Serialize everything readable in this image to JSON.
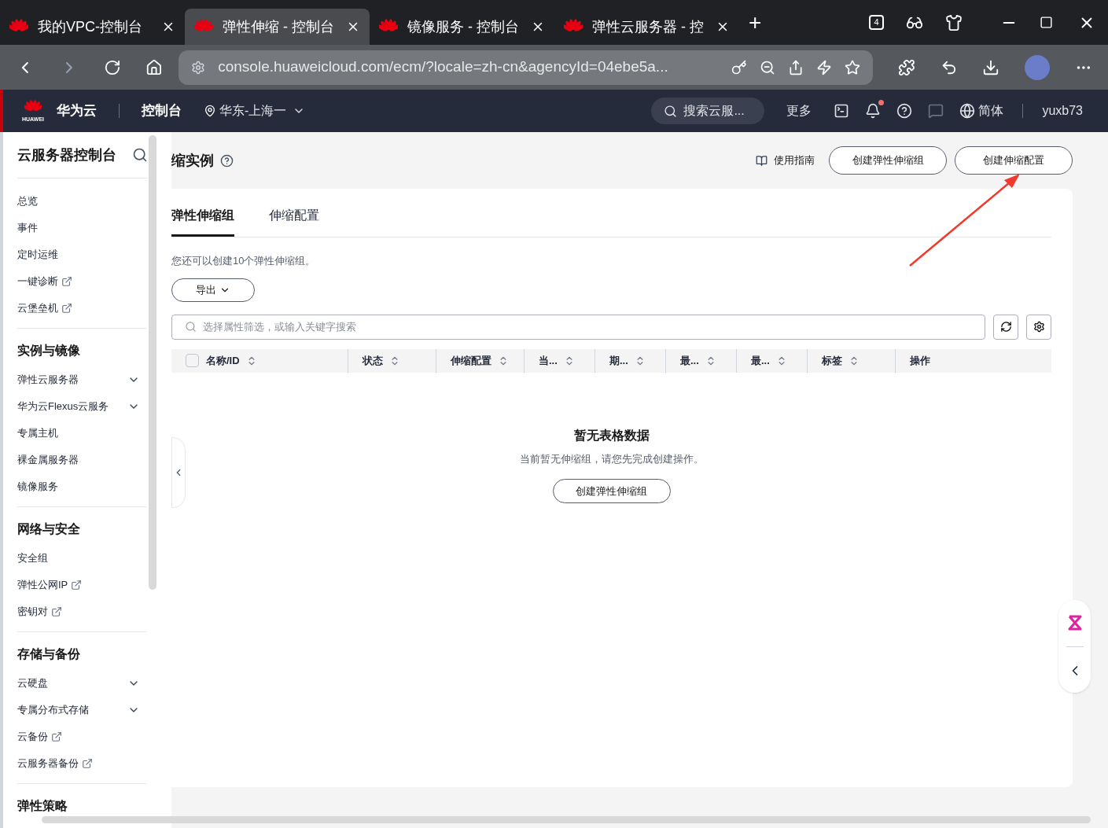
{
  "browser": {
    "tabs": [
      {
        "title": "我的VPC-控制台",
        "selected": false
      },
      {
        "title": "弹性伸缩 - 控制台",
        "selected": true
      },
      {
        "title": "镜像服务 - 控制台",
        "selected": false
      },
      {
        "title": "弹性云服务器 - 控",
        "selected": false
      }
    ],
    "new_tab": "+",
    "tab_count": "4",
    "url": "console.huaweicloud.com/ecm/?locale=zh-cn&agencyId=04ebe5a..."
  },
  "header": {
    "brand": "华为云",
    "logo_text": "HUAWEI",
    "console": "控制台",
    "region": "华东-上海一",
    "search_placeholder": "搜索云服...",
    "more": "更多",
    "language": "简体",
    "user": "yuxb73",
    "notification_dot": true
  },
  "sidebar": {
    "title": "云服务器控制台",
    "sections": [
      {
        "items": [
          {
            "label": "总览",
            "kind": "plain"
          },
          {
            "label": "事件",
            "kind": "plain"
          },
          {
            "label": "定时运维",
            "kind": "plain"
          },
          {
            "label": "一键诊断",
            "kind": "external"
          },
          {
            "label": "云堡垒机",
            "kind": "external"
          }
        ]
      },
      {
        "title": "实例与镜像",
        "items": [
          {
            "label": "弹性云服务器",
            "kind": "expand"
          },
          {
            "label": "华为云Flexus云服务",
            "kind": "expand"
          },
          {
            "label": "专属主机",
            "kind": "plain"
          },
          {
            "label": "裸金属服务器",
            "kind": "plain"
          },
          {
            "label": "镜像服务",
            "kind": "plain"
          }
        ]
      },
      {
        "title": "网络与安全",
        "items": [
          {
            "label": "安全组",
            "kind": "plain"
          },
          {
            "label": "弹性公网IP",
            "kind": "external"
          },
          {
            "label": "密钥对",
            "kind": "external"
          }
        ]
      },
      {
        "title": "存储与备份",
        "items": [
          {
            "label": "云硬盘",
            "kind": "expand"
          },
          {
            "label": "专属分布式存储",
            "kind": "expand"
          },
          {
            "label": "云备份",
            "kind": "external"
          },
          {
            "label": "云服务器备份",
            "kind": "external"
          }
        ]
      },
      {
        "title": "弹性策略"
      }
    ]
  },
  "page": {
    "title": "缩实例",
    "guide": "使用指南",
    "buttons": [
      "创建弹性伸缩组",
      "创建伸缩配置"
    ],
    "tabs": [
      {
        "label": "弹性伸缩组",
        "selected": true
      },
      {
        "label": "伸缩配置",
        "selected": false
      }
    ],
    "quota_note": "您还可以创建10个弹性伸缩组。",
    "export": "导出",
    "search_placeholder": "选择属性筛选，或输入关键字搜索",
    "table": {
      "select_all_checked": false,
      "columns": [
        {
          "label": "名称/ID",
          "sortable": true
        },
        {
          "label": "状态",
          "sortable": true
        },
        {
          "label": "伸缩配置",
          "sortable": true
        },
        {
          "label": "当...",
          "sortable": true
        },
        {
          "label": "期...",
          "sortable": true
        },
        {
          "label": "最...",
          "sortable": true
        },
        {
          "label": "最...",
          "sortable": true
        },
        {
          "label": "标签",
          "sortable": true
        },
        {
          "label": "操作",
          "sortable": false
        }
      ]
    },
    "empty": {
      "title": "暂无表格数据",
      "message": "当前暂无伸缩组，请您先完成创建操作。",
      "button": "创建弹性伸缩组"
    }
  }
}
